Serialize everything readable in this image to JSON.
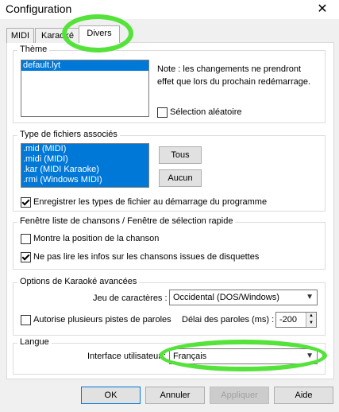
{
  "window": {
    "title": "Configuration",
    "close_glyph": "✕"
  },
  "tabs": [
    {
      "label": "MIDI"
    },
    {
      "label": "Karaoké"
    },
    {
      "label": "Divers"
    }
  ],
  "theme": {
    "legend": "Thème",
    "items": [
      "default.lyt"
    ],
    "note": "Note : les changements ne prendront effet que lors du prochain redémarrage.",
    "random_label": "Sélection aléatoire",
    "random_checked": false
  },
  "filetypes": {
    "legend": "Type de fichiers associés",
    "items": [
      ".mid (MIDI)",
      ".midi (MIDI)",
      ".kar (MIDI Karaoke)",
      ".rmi (Windows MIDI)"
    ],
    "all_button": "Tous",
    "none_button": "Aucun",
    "register_label": "Enregistrer les types de fichier au démarrage du programme",
    "register_checked": true
  },
  "songlist": {
    "legend": "Fenêtre liste de chansons / Fenêtre de sélection rapide",
    "show_pos_label": "Montre la position de la chanson",
    "show_pos_checked": false,
    "no_floppy_label": "Ne pas lire les infos sur les chansons issues de disquettes",
    "no_floppy_checked": true
  },
  "karaoke": {
    "legend": "Options de Karaoké avancées",
    "charset_label": "Jeu de caractères :",
    "charset_value": "Occidental (DOS/Windows)",
    "multi_tracks_label": "Autorise plusieurs pistes de paroles",
    "multi_tracks_checked": false,
    "delay_label": "Délai des paroles (ms) :",
    "delay_value": "-200"
  },
  "language": {
    "legend": "Langue",
    "ui_label": "Interface utilisateur :",
    "ui_value": "Français"
  },
  "footer": {
    "ok": "OK",
    "cancel": "Annuler",
    "apply": "Appliquer",
    "help": "Aide"
  },
  "colors": {
    "selection": "#0078d7",
    "highlight": "#55e33b"
  }
}
